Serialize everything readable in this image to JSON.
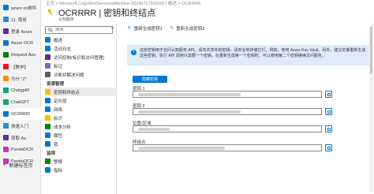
{
  "tabs": [
    {
      "title": "azure on邮件",
      "color": "#0078d4"
    },
    {
      "title": "11. 使用",
      "color": "#2b88d8"
    },
    {
      "title": "登录 Azure",
      "color": "#5c2d91"
    },
    {
      "title": "Azure OCR",
      "color": "#0078d4"
    },
    {
      "title": "Request Azu",
      "color": "#107c10"
    },
    {
      "title": "【教学】",
      "color": "#e81123"
    },
    {
      "title": "为什 \"Z\"",
      "color": "#ff8c00"
    },
    {
      "title": "ChatgptR",
      "color": "#10a37f"
    },
    {
      "title": "ChatGPT",
      "color": "#10a37f"
    },
    {
      "title": "OCRRRR",
      "color": "#0078d4"
    },
    {
      "title": "快速入门",
      "color": "#2b88d8"
    },
    {
      "title": "获取 Az",
      "color": "#5c2d91"
    },
    {
      "title": "PandaOCR",
      "color": "#c239b3"
    },
    {
      "title": "PandaOCR",
      "color": "#c239b3"
    }
  ],
  "new_tab_label": "新建标签页",
  "breadcrumb": "主页 > Microsoft.CognitiveServicesAllInOne-20230717201100 | 概述 > OCRRRR",
  "title": "OCRRRR | 密钥和终结点",
  "subtitle": "认知服务",
  "search_placeholder": "搜索",
  "nav": {
    "top_items": [
      {
        "label": "概述",
        "color": "#0078d4"
      },
      {
        "label": "活动日志",
        "color": "#0078d4"
      },
      {
        "label": "访问控制(标识和访问管理)",
        "color": "#5c2d91"
      },
      {
        "label": "标记",
        "color": "#8764b8"
      },
      {
        "label": "诊断并解决问题",
        "color": "#605e5c"
      }
    ],
    "section_resource": "资源管理",
    "resource_items": [
      {
        "label": "密钥和终结点",
        "color": "#ffb900"
      },
      {
        "label": "定价层",
        "color": "#0078d4"
      },
      {
        "label": "网络",
        "color": "#0078d4"
      },
      {
        "label": "标识",
        "color": "#ffb900"
      },
      {
        "label": "成本分析",
        "color": "#107c10"
      },
      {
        "label": "属性",
        "color": "#0078d4"
      },
      {
        "label": "锁",
        "color": "#0078d4"
      }
    ],
    "section_monitor": "监视",
    "monitor_items": [
      {
        "label": "警报",
        "color": "#107c10"
      },
      {
        "label": "指标",
        "color": "#0078d4"
      }
    ]
  },
  "commands": {
    "regen_key1": "重新生成密钥1",
    "regen_key2": "重新生成密钥2"
  },
  "banner_text": "这些密钥用于访问认知服务 API。请勿共享你的密钥。请安全地存储它们，例如，使用 Azure Key Vault。另外，建议定期重新生成这些密钥。执行 API 调用只需要一个密钥。在重新生成第一个密钥时，可以使用第二个密钥继续访问服务。",
  "show_keys_button": "隐藏密钥",
  "fields": {
    "key1_label": "密钥 1",
    "key2_label": "密钥 2",
    "region_label": "位置/区域",
    "endpoint_label": "终结点"
  },
  "colors": {
    "accent": "#0078d4",
    "banner_bg": "#deecf9",
    "key_icon": "#ffb900"
  }
}
